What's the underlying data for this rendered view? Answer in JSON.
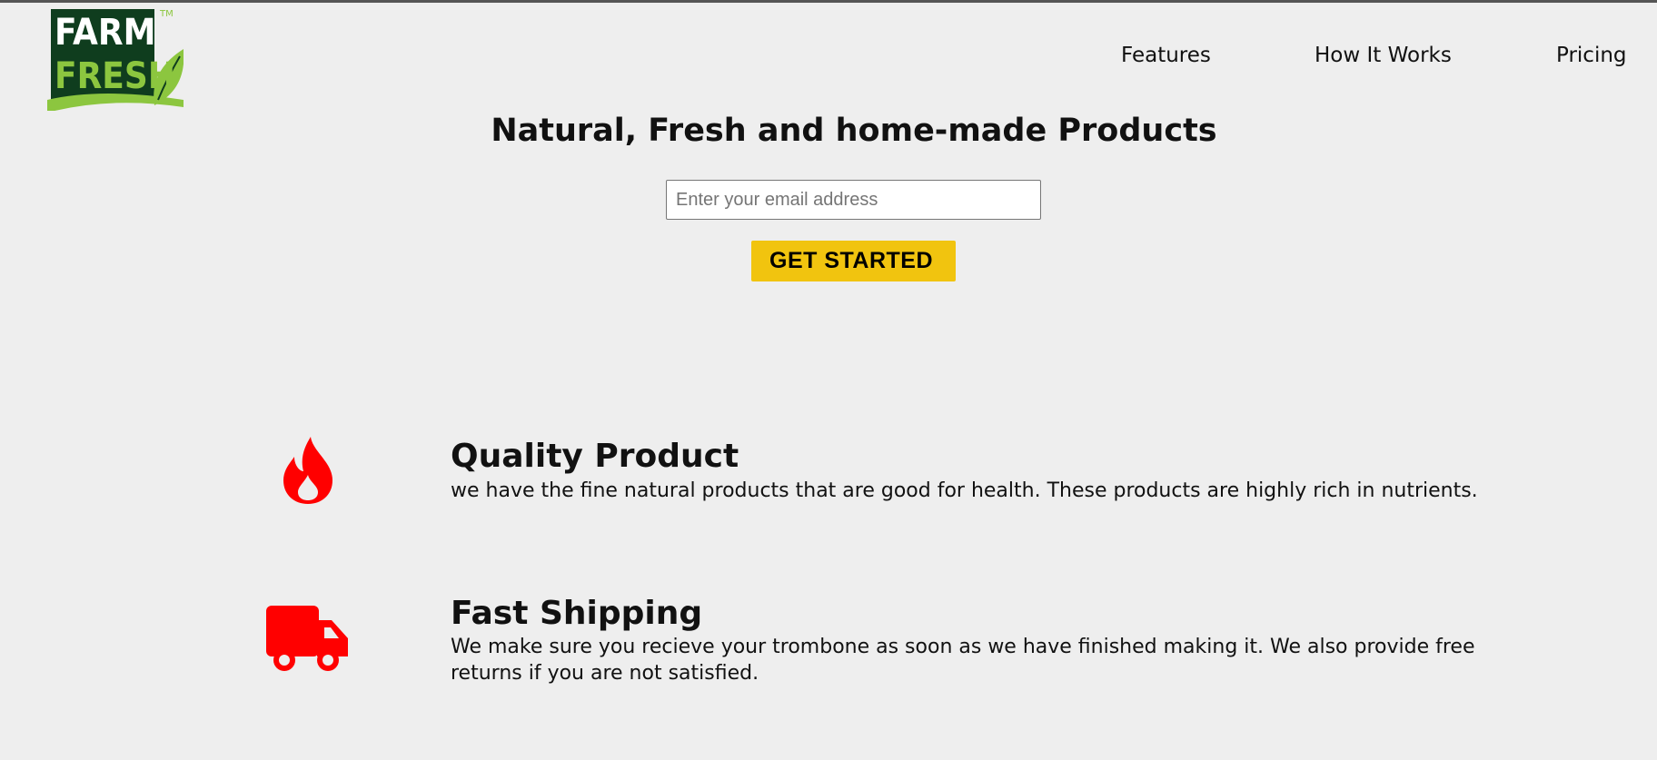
{
  "logo": {
    "line1": "FARM",
    "line2": "FRESH",
    "tm": "TM"
  },
  "nav": [
    {
      "label": "Features"
    },
    {
      "label": "How It Works"
    },
    {
      "label": "Pricing"
    }
  ],
  "hero": {
    "title": "Natural, Fresh and home-made Products",
    "email_placeholder": "Enter your email address",
    "cta_label": "GET STARTED"
  },
  "features": [
    {
      "icon": "fire-icon",
      "title": "Quality Product",
      "description": "we have the fine natural products that are good for health. These products are highly rich in nutrients."
    },
    {
      "icon": "truck-icon",
      "title": "Fast Shipping",
      "description": "We make sure you recieve your trombone as soon as we have finished making it. We also provide free returns if you are not satisfied."
    }
  ],
  "colors": {
    "background": "#eeeeee",
    "accent_yellow": "#f1c40f",
    "icon_red": "#ff0000",
    "logo_dark_green": "#0f3d1e",
    "logo_light_green": "#8cc63f"
  }
}
